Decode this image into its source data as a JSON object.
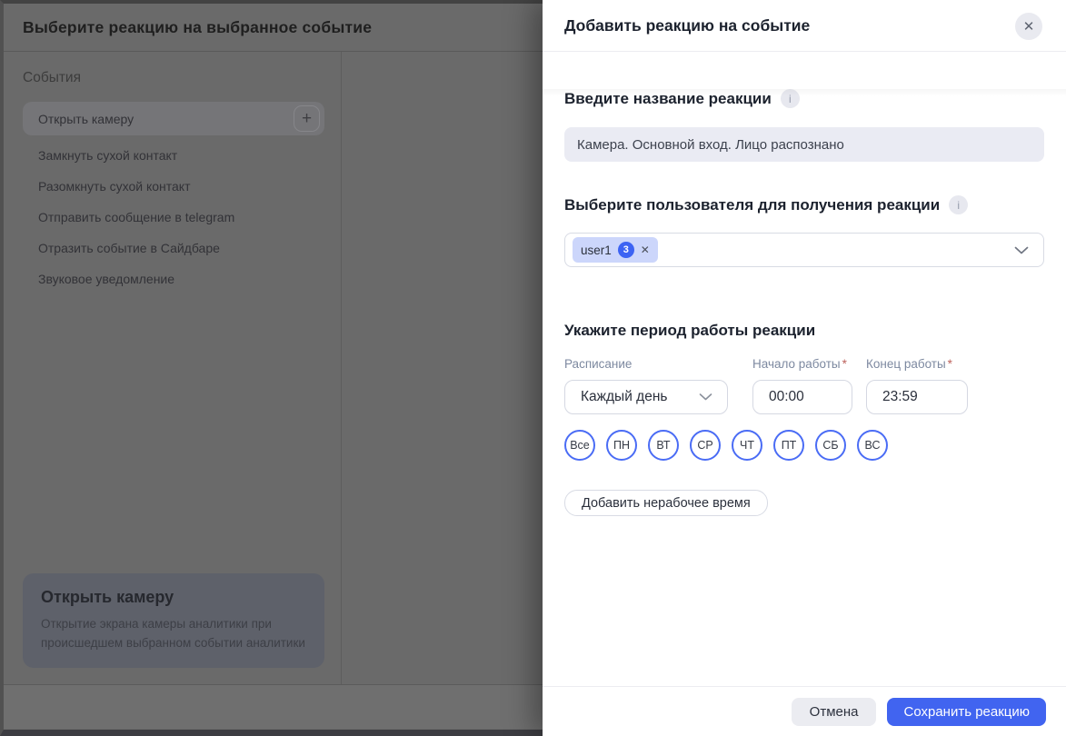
{
  "icons": {
    "add": "+",
    "close": "✕",
    "remove": "✕",
    "info": "i",
    "chevron_down": "⌄"
  },
  "colors": {
    "accent_blue": "#4164f0",
    "day_outline_blue": "#4a6cf5",
    "chip_background": "#ccd6fb",
    "badge_blue": "#3c63f3",
    "dim_background": "#6a6a6a"
  },
  "background": {
    "title": "Выберите реакцию на выбранное событие",
    "section_title": "События",
    "events": [
      "Открыть камеру",
      "Замкнуть сухой контакт",
      "Разомкнуть сухой контакт",
      "Отправить сообщение в telegram",
      "Отразить событие в Сайдбаре",
      "Звуковое уведомление"
    ],
    "detail_card": {
      "title": "Открыть камеру",
      "description": "Открытие экрана камеры аналитики при происшедшем выбранном событии аналитики"
    }
  },
  "modal": {
    "title": "Добавить реакцию на событие",
    "name_field": {
      "label": "Введите название реакции",
      "value": "Камера. Основной вход. Лицо распознано"
    },
    "user_field": {
      "label": "Выберите пользователя для получения реакции",
      "chip": {
        "name": "user1",
        "count": "3"
      }
    },
    "period": {
      "heading": "Укажите период работы реакции",
      "schedule": {
        "label": "Расписание",
        "value": "Каждый день"
      },
      "start": {
        "label": "Начало работы",
        "required": "*",
        "value": "00:00"
      },
      "end": {
        "label": "Конец работы",
        "required": "*",
        "value": "23:59"
      },
      "days": [
        "Все",
        "ПН",
        "ВТ",
        "СР",
        "ЧТ",
        "ПТ",
        "СБ",
        "ВС"
      ],
      "add_offtime_label": "Добавить нерабочее время"
    },
    "footer": {
      "cancel_label": "Отмена",
      "save_label": "Сохранить реакцию"
    }
  }
}
